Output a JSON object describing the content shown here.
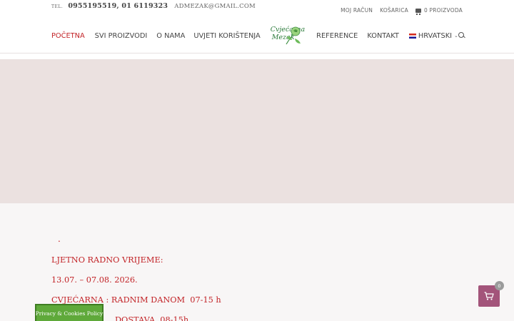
{
  "topbar": {
    "tel_label": "TEL.",
    "phones": "0955195519, 01 6119323",
    "email": "ADMEZAK@GMAIL.COM",
    "links": {
      "account": "MOJ RAČUN",
      "basket": "KOŠARICA",
      "cart_count": "0 PROIZVODA"
    }
  },
  "nav": {
    "home": "POČETNA",
    "products": "SVI PROIZVODI",
    "about": "O NAMA",
    "terms": "UVJETI KORIŠTENJA",
    "references": "REFERENCE",
    "contact": "KONTAKT",
    "language": "HRVATSKI"
  },
  "logo": {
    "line1": "Cvjećarna",
    "line2": "Mezak"
  },
  "content": {
    "dot": ".",
    "lines": [
      "LJETNO RADNO VRIJEME:",
      "13.07. – 07.08. 2026.",
      "CVJEĆARNA : RADNIM DANOM  07-15 h",
      "DOSTAVA  08-15h"
    ]
  },
  "cookie_button": "Privacy & Cookies Policy",
  "floating_cart": {
    "count": "0"
  },
  "colors": {
    "accent_red": "#c22327",
    "banner": "#ebe1e0",
    "cookie_green": "#5fa93a",
    "cart_purple": "#a3547a",
    "logo_green": "#2a7a3a"
  },
  "icons": [
    "cart-icon",
    "flag-croatia-icon",
    "chevron-down-icon",
    "search-icon",
    "rose-icon"
  ]
}
